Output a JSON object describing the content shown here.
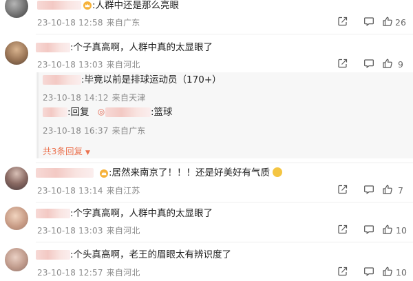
{
  "comments": [
    {
      "text": ":人群中还是那么亮眼",
      "date": "23-10-18 12:58",
      "location": "来自广东",
      "like_count": "26"
    },
    {
      "text": ":个子真高啊，人群中真的太显眼了",
      "date": "23-10-18 13:03",
      "location": "来自河北",
      "like_count": "9",
      "replies": [
        {
          "text": ":毕竟以前是排球运动员（170+）",
          "date": "23-10-18 14:12",
          "location": "来自天津"
        },
        {
          "reply_prefix": ":回复",
          "text": ":篮球",
          "date": "23-10-18 16:37",
          "location": "来自广东"
        }
      ],
      "more_replies": "共3条回复"
    },
    {
      "text": ":居然来南京了！！！还是好美好有气质",
      "date": "23-10-18 13:14",
      "location": "来自江苏",
      "like_count": "7"
    },
    {
      "text": ":个字真高啊，人群中真的太显眼了",
      "date": "23-10-18 13:03",
      "location": "来自河北",
      "like_count": "10"
    },
    {
      "text": ":个头真高啊，老王的眉眼太有辨识度了",
      "date": "23-10-18 12:57",
      "location": "来自河北",
      "like_count": "10"
    }
  ],
  "icons": {
    "share": "share-icon",
    "comment": "comment-icon",
    "like": "thumbs-up-icon",
    "crown": "crown-icon",
    "dropdown": "caret-down-icon"
  },
  "colors": {
    "text": "#222222",
    "meta": "#8a8a8a",
    "accent": "#eb7350",
    "reply_bg": "#f7f7f7"
  }
}
